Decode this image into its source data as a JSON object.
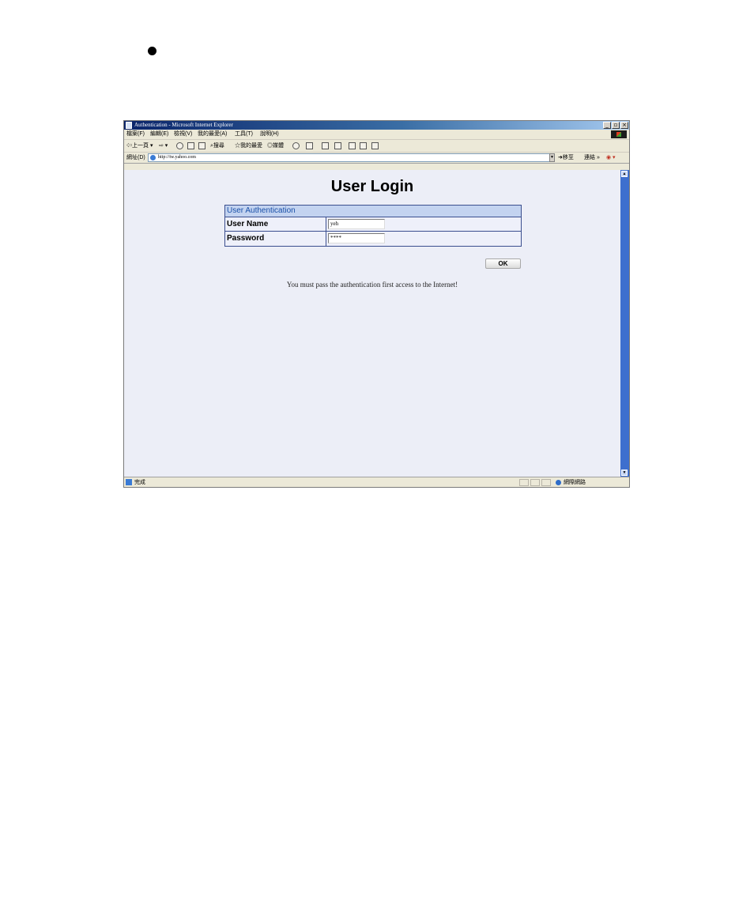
{
  "window": {
    "title": "Authentication - Microsoft Internet Explorer",
    "controls": {
      "minimize": "_",
      "maximize": "▫",
      "close": "×"
    }
  },
  "menubar": {
    "items": [
      "檔案(F)",
      "編輯(E)",
      "檢視(V)",
      "我的最愛(A)",
      "工具(T)",
      "說明(H)"
    ]
  },
  "toolbar": {
    "back": "上一頁",
    "search": "搜尋",
    "favorites": "我的最愛",
    "media": "媒體"
  },
  "addressbar": {
    "label": "網址(D)",
    "url": "http://tw.yahoo.com",
    "go": "移至",
    "links": "連結 »"
  },
  "page": {
    "title": "User Login",
    "section_header": "User Authentication",
    "username_label": "User Name",
    "username_value": "yeh",
    "password_label": "Password",
    "password_value": "****",
    "ok_label": "OK",
    "notice": "You must pass the authentication first access to the Internet!"
  },
  "statusbar": {
    "status": "完成",
    "zone": "網際網路"
  }
}
